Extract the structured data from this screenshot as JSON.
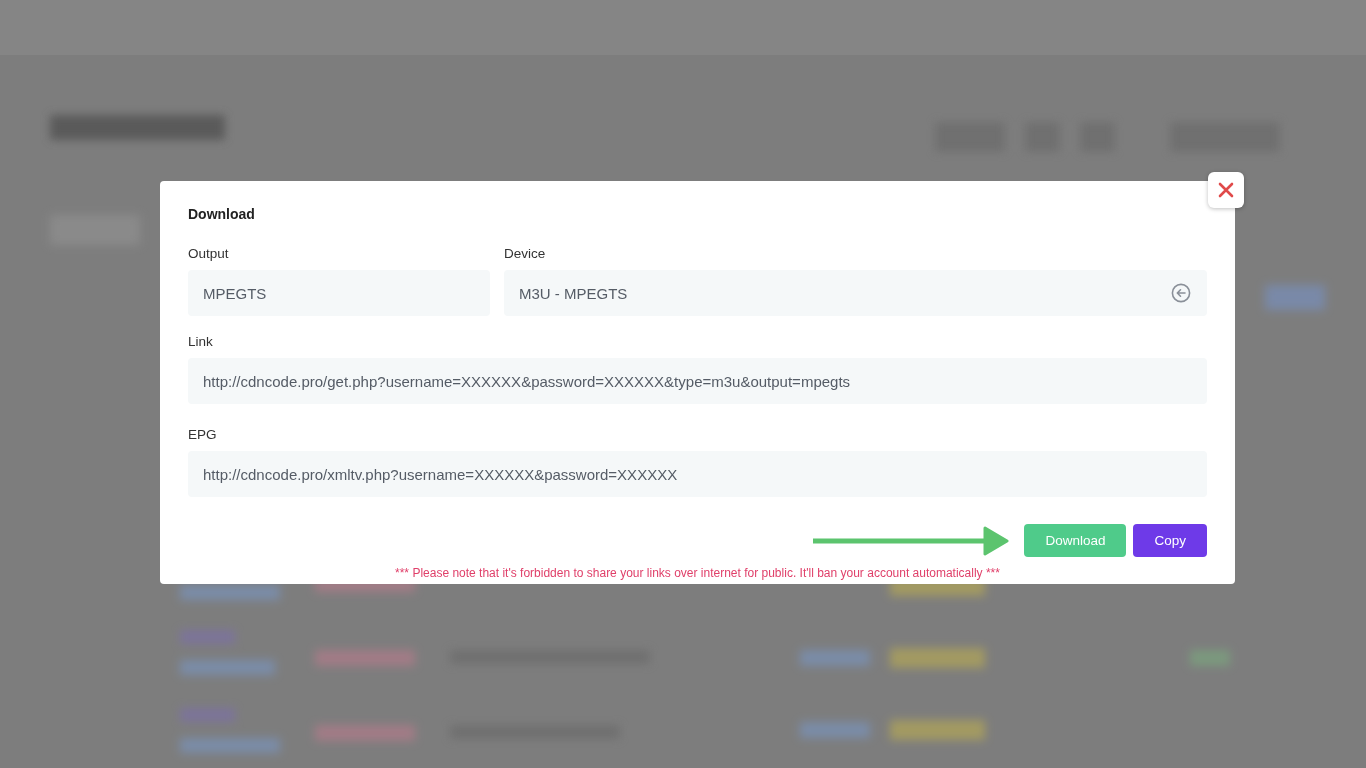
{
  "dialog": {
    "title": "Download",
    "fields": [
      {
        "label": "Output",
        "value": "MPEGTS",
        "kind": "input"
      },
      {
        "label": "Device",
        "value": "M3U - MPEGTS",
        "kind": "select"
      },
      {
        "label": "Link",
        "value": "http://cdncode.pro/get.php?username=XXXXXX&password=XXXXXX&type=m3u&output=mpegts",
        "kind": "input"
      },
      {
        "label": "EPG",
        "value": "http://cdncode.pro/xmltv.php?username=XXXXXX&password=XXXXXX",
        "kind": "input"
      }
    ],
    "buttons": [
      {
        "label": "Download",
        "kind": "download"
      },
      {
        "label": "Copy",
        "kind": "copy"
      }
    ],
    "notice": "*** Please note that it's forbidden to share your links over internet for public. It'll ban your account automatically ***"
  }
}
